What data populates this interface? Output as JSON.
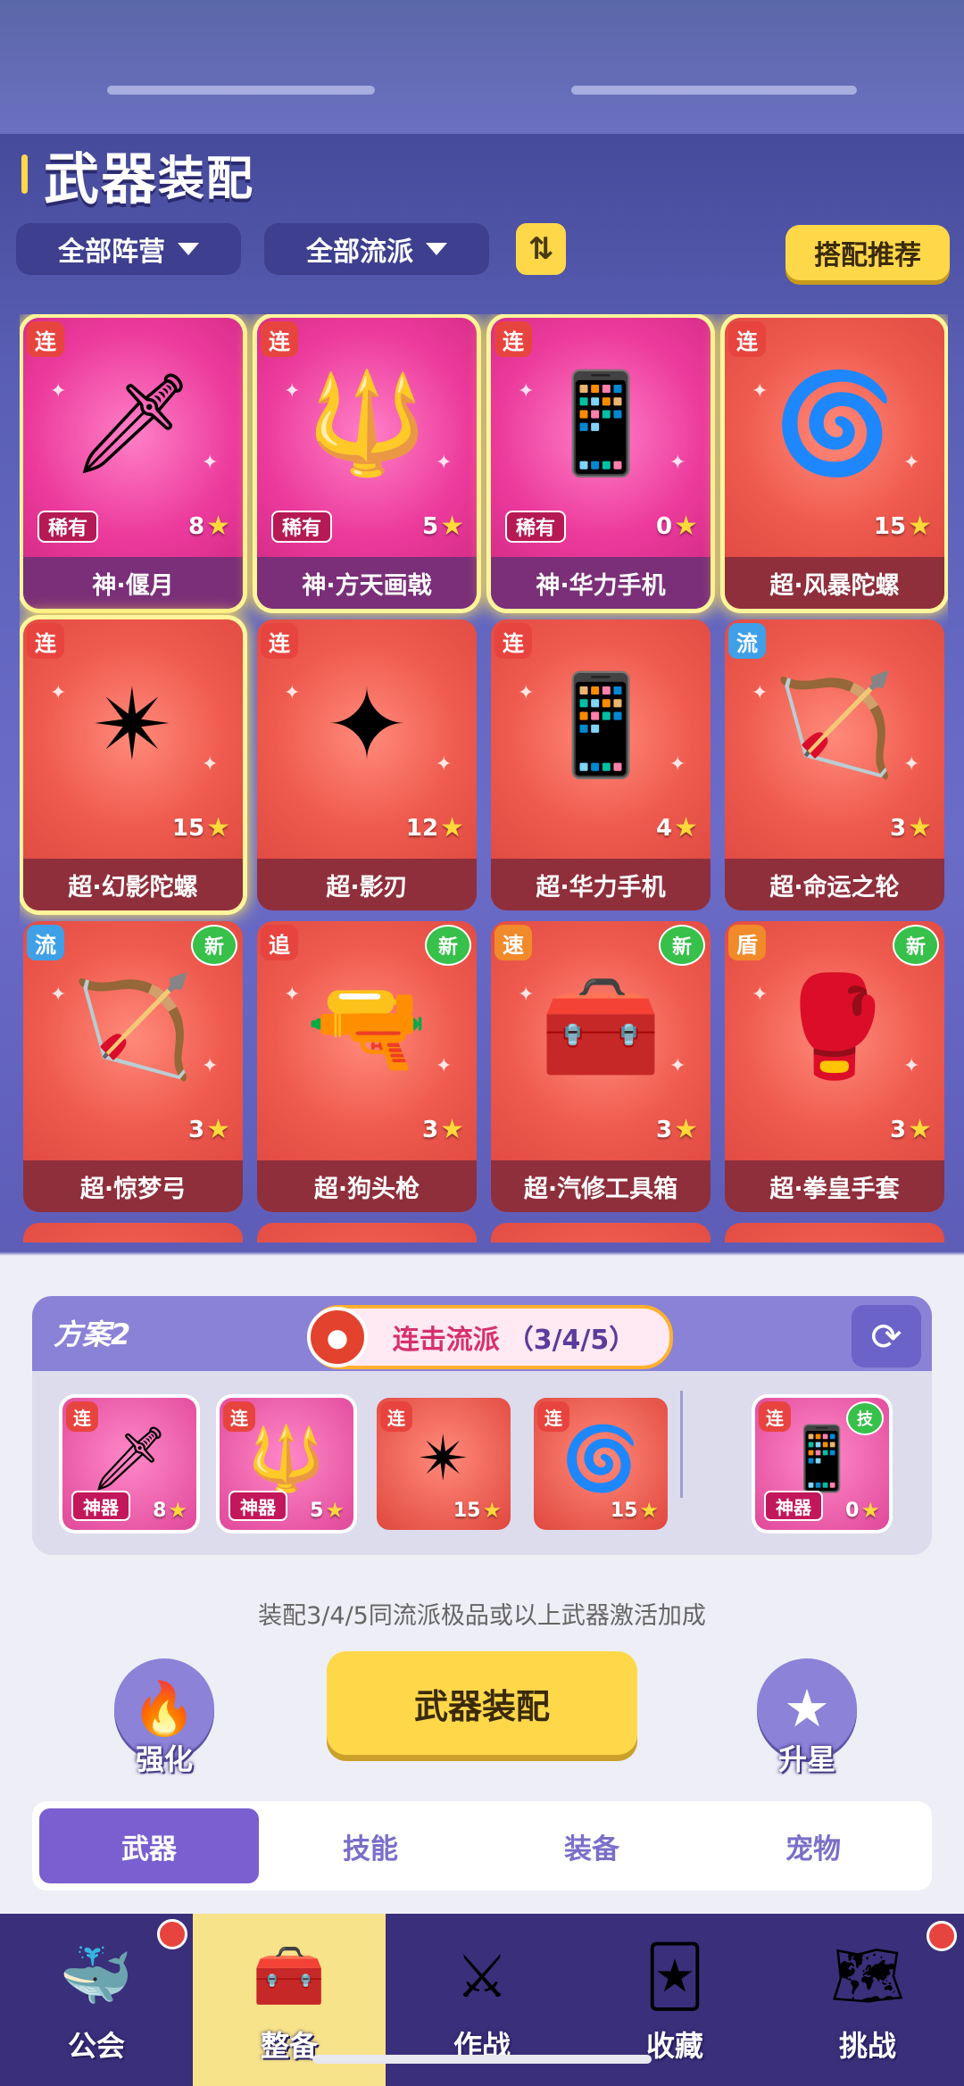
{
  "header": {
    "title_a": "武器",
    "title_b": "装配"
  },
  "filters": {
    "faction": "全部阵营",
    "school": "全部流派",
    "sort_icon": "swap-vertical-icon",
    "recommend": "搭配推荐"
  },
  "weapons": [
    {
      "tag": "连",
      "name": "神·偃月",
      "stars": "8",
      "rare": "稀有",
      "new": "",
      "theme": "pink",
      "glow": true
    },
    {
      "tag": "连",
      "name": "神·方天画戟",
      "stars": "5",
      "rare": "稀有",
      "new": "",
      "theme": "pink",
      "glow": true
    },
    {
      "tag": "连",
      "name": "神·华力手机",
      "stars": "0",
      "rare": "稀有",
      "new": "",
      "theme": "pink",
      "glow": true
    },
    {
      "tag": "连",
      "name": "超·风暴陀螺",
      "stars": "15",
      "rare": "",
      "new": "",
      "theme": "red",
      "glow": true
    },
    {
      "tag": "连",
      "name": "超·幻影陀螺",
      "stars": "15",
      "rare": "",
      "new": "",
      "theme": "red",
      "glow": true
    },
    {
      "tag": "连",
      "name": "超·影刃",
      "stars": "12",
      "rare": "",
      "new": "",
      "theme": "red",
      "glow": false
    },
    {
      "tag": "连",
      "name": "超·华力手机",
      "stars": "4",
      "rare": "",
      "new": "",
      "theme": "red",
      "glow": false
    },
    {
      "tag": "流",
      "name": "超·命运之轮",
      "stars": "3",
      "rare": "",
      "new": "",
      "theme": "red",
      "glow": false
    },
    {
      "tag": "流",
      "name": "超·惊梦弓",
      "stars": "3",
      "rare": "",
      "new": "新",
      "theme": "red",
      "glow": false
    },
    {
      "tag": "追",
      "name": "超·狗头枪",
      "stars": "3",
      "rare": "",
      "new": "新",
      "theme": "red",
      "glow": false
    },
    {
      "tag": "速",
      "name": "超·汽修工具箱",
      "stars": "3",
      "rare": "",
      "new": "新",
      "theme": "red",
      "glow": false
    },
    {
      "tag": "盾",
      "name": "超·拳皇手套",
      "stars": "3",
      "rare": "",
      "new": "新",
      "theme": "red",
      "glow": false
    }
  ],
  "loadout": {
    "plan_name": "方案2",
    "combo_label": "连击流派",
    "combo_count": "（3/4/5）",
    "slots": [
      {
        "tag": "连",
        "badge": "神器",
        "stars": "8",
        "theme": "pink",
        "new": ""
      },
      {
        "tag": "连",
        "badge": "神器",
        "stars": "5",
        "theme": "pink",
        "new": ""
      },
      {
        "tag": "连",
        "badge": "",
        "stars": "15",
        "theme": "red",
        "new": ""
      },
      {
        "tag": "连",
        "badge": "",
        "stars": "15",
        "theme": "red",
        "new": ""
      }
    ],
    "extra_slot": {
      "tag": "连",
      "badge": "神器",
      "stars": "0",
      "new": "技"
    }
  },
  "hint": "装配3/4/5同流派极品或以上武器激活加成",
  "actions": {
    "upgrade": "强化",
    "equip": "武器装配",
    "star_up": "升星"
  },
  "tabs": [
    "武器",
    "技能",
    "装备",
    "宠物"
  ],
  "nav": [
    "公会",
    "整备",
    "作战",
    "收藏",
    "挑战"
  ],
  "colors": {
    "accent": "#ffd84a",
    "primary": "#7a5fd0",
    "nav_bg": "#3a2f7a",
    "active_nav": "#f7e38a"
  }
}
